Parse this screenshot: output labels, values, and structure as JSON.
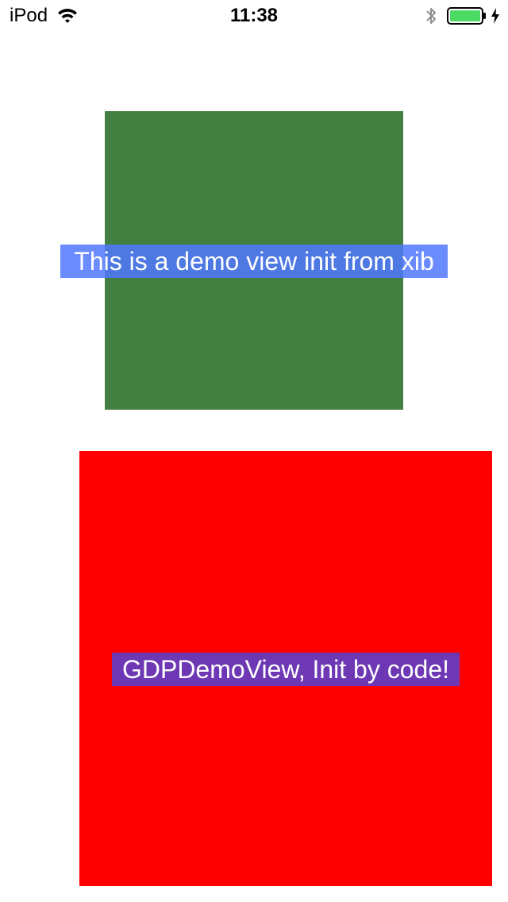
{
  "status_bar": {
    "carrier": "iPod",
    "time": "11:38",
    "wifi_icon": "wifi-icon",
    "bluetooth_icon": "bluetooth-icon",
    "battery_icon": "battery-icon",
    "charging_icon": "charging-bolt-icon",
    "battery_level": 1.0,
    "battery_color": "#4cd964"
  },
  "xib_view": {
    "background_color": "#437f41",
    "label": "This is a demo view init from xib",
    "label_background": "rgba(80,120,255,0.85)"
  },
  "code_view": {
    "background_color": "#ff0000",
    "label": "GDPDemoView, Init by code!",
    "label_background": "#6e38b4"
  }
}
